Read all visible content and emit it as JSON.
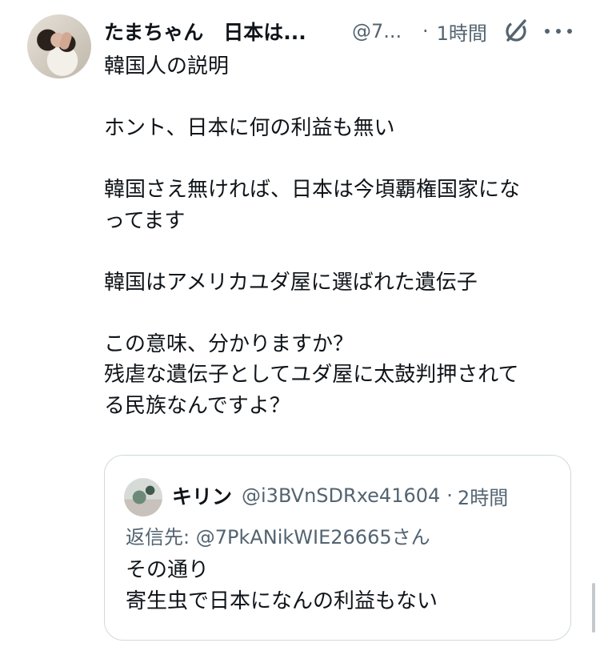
{
  "tweet": {
    "author": {
      "display_name": "たまちゃん　日本は...",
      "handle": "@7...",
      "avatar": "user-photo"
    },
    "time": "1時間",
    "separator": "·",
    "icons": {
      "grok": "grok-icon",
      "more": "more-icon"
    },
    "text_lines": [
      "韓国人の説明",
      "",
      "ホント、日本に何の利益も無い",
      "",
      "韓国さえ無ければ、日本は今頃覇権国家にな",
      "ってます",
      "",
      "韓国はアメリカユダ屋に選ばれた遺伝子",
      "",
      "この意味、分かりますか？",
      "残虐な遺伝子としてユダ屋に太鼓判押されて",
      "る民族なんですよ？"
    ]
  },
  "quoted_tweet": {
    "author": {
      "display_name": "キリン",
      "handle": "@i3BVnSDRxe41604"
    },
    "separator": "·",
    "time": "2時間",
    "reply_to_label": "返信先: ",
    "reply_to_handle": "@7PkANikWIE26665",
    "reply_to_suffix": "さん",
    "text_lines": [
      "その通り",
      "寄生虫で日本になんの利益もない"
    ]
  },
  "colors": {
    "text_primary": "#0f1419",
    "text_secondary": "#536471",
    "border": "#cfd9de"
  }
}
